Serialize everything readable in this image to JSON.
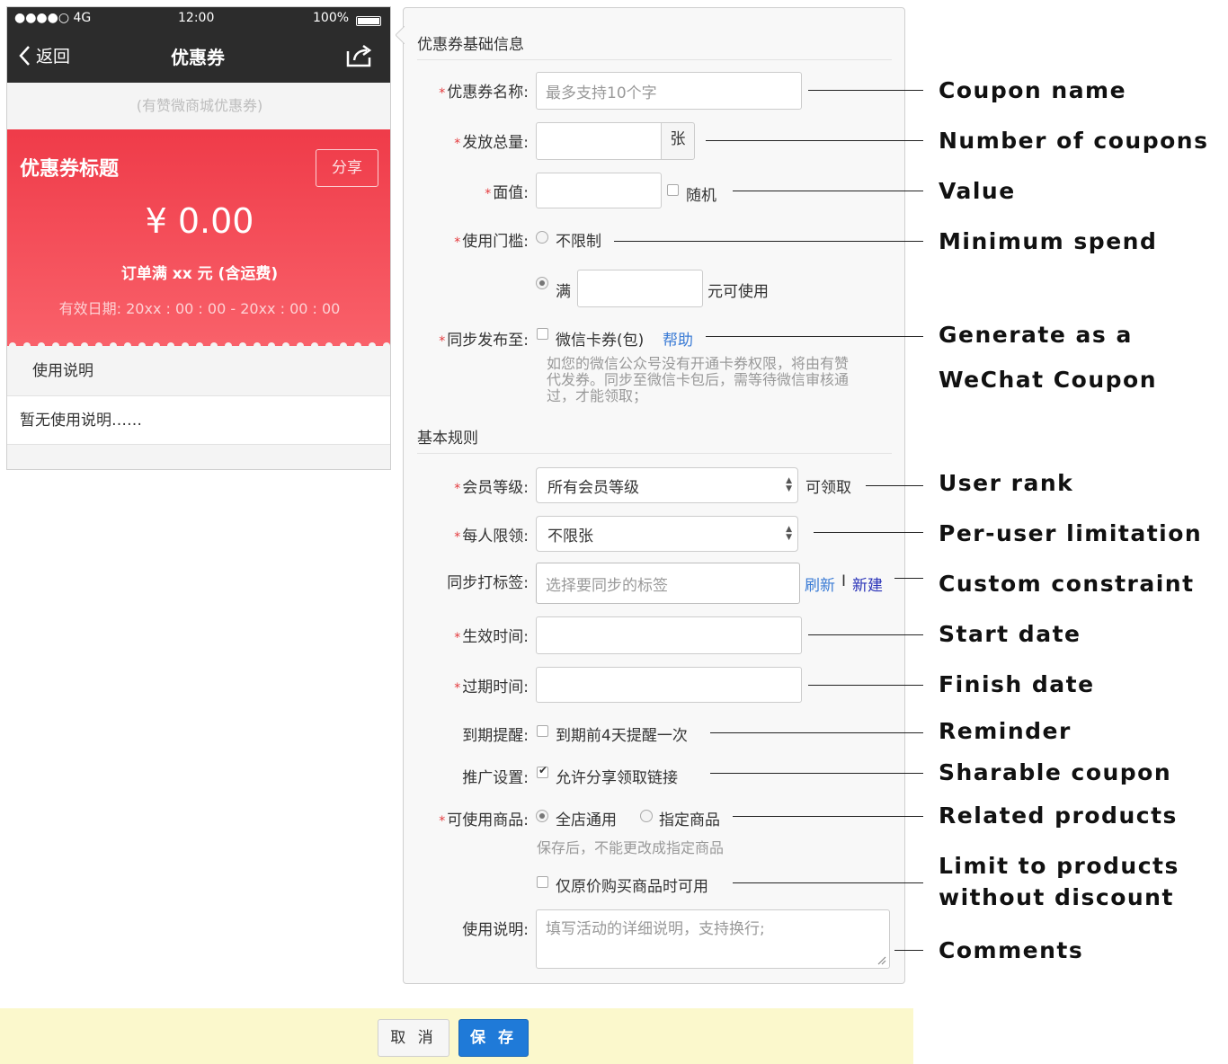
{
  "phone": {
    "status": {
      "carrier": "●●●●○ 4G",
      "time": "12:00",
      "battery": "100%"
    },
    "nav": {
      "back": "返回",
      "title": "优惠券"
    },
    "subtitle": "(有赞微商城优惠券)",
    "card": {
      "title": "优惠券标题",
      "share": "分享",
      "amount": "¥  0.00",
      "condition": "订单满 xx 元 (含运费)",
      "validity": "有效日期:  20xx : 00 : 00 - 20xx : 00 : 00"
    },
    "desc_title": "使用说明",
    "desc_body": "暂无使用说明……"
  },
  "form": {
    "basic_section": "优惠券基础信息",
    "name": {
      "label": "优惠券名称:",
      "placeholder": "最多支持10个字"
    },
    "total": {
      "label": "发放总量:",
      "unit": "张"
    },
    "value": {
      "label": "面值:",
      "random": "随机"
    },
    "threshold": {
      "label": "使用门槛:",
      "option_none": "不限制",
      "option_full": "满",
      "suffix": "元可使用"
    },
    "sync": {
      "label": "同步发布至:",
      "wechat": "微信卡券(包)",
      "help": "帮助",
      "note": [
        "如您的微信公众号没有开通卡券权限，将由有赞",
        "代发券。同步至微信卡包后，需等待微信审核通",
        "过，才能领取；"
      ]
    },
    "rules_section": "基本规则",
    "member": {
      "label": "会员等级:",
      "selected": "所有会员等级",
      "suffix": "可领取"
    },
    "limit": {
      "label": "每人限领:",
      "selected": "不限张"
    },
    "tag": {
      "label": "同步打标签:",
      "placeholder": "选择要同步的标签",
      "refresh": "刷新",
      "sep": "I",
      "new": "新建"
    },
    "start": {
      "label": "生效时间:"
    },
    "end": {
      "label": "过期时间:"
    },
    "remind": {
      "label": "到期提醒:",
      "option": "到期前4天提醒一次"
    },
    "promo": {
      "label": "推广设置:",
      "option": "允许分享领取链接"
    },
    "goods": {
      "label": "可使用商品:",
      "all": "全店通用",
      "specific": "指定商品",
      "note": "保存后，不能更改成指定商品",
      "original_price": "仅原价购买商品时可用"
    },
    "comment": {
      "label": "使用说明:",
      "placeholder": "填写活动的详细说明，支持换行;"
    }
  },
  "annotations": {
    "coupon_name": "Coupon name",
    "number": "Number of coupons",
    "value": "Value",
    "min_spend": "Minimum spend",
    "wechat_1": "Generate as a",
    "wechat_2": "WeChat Coupon",
    "user_rank": "User rank",
    "per_user": "Per-user limitation",
    "custom": "Custom constraint",
    "start": "Start date",
    "finish": "Finish date",
    "reminder": "Reminder",
    "sharable": "Sharable coupon",
    "related": "Related products",
    "limit_1": "Limit to products",
    "limit_2": "without discount",
    "comments": "Comments"
  },
  "footer": {
    "cancel": "取 消",
    "save": "保 存"
  }
}
